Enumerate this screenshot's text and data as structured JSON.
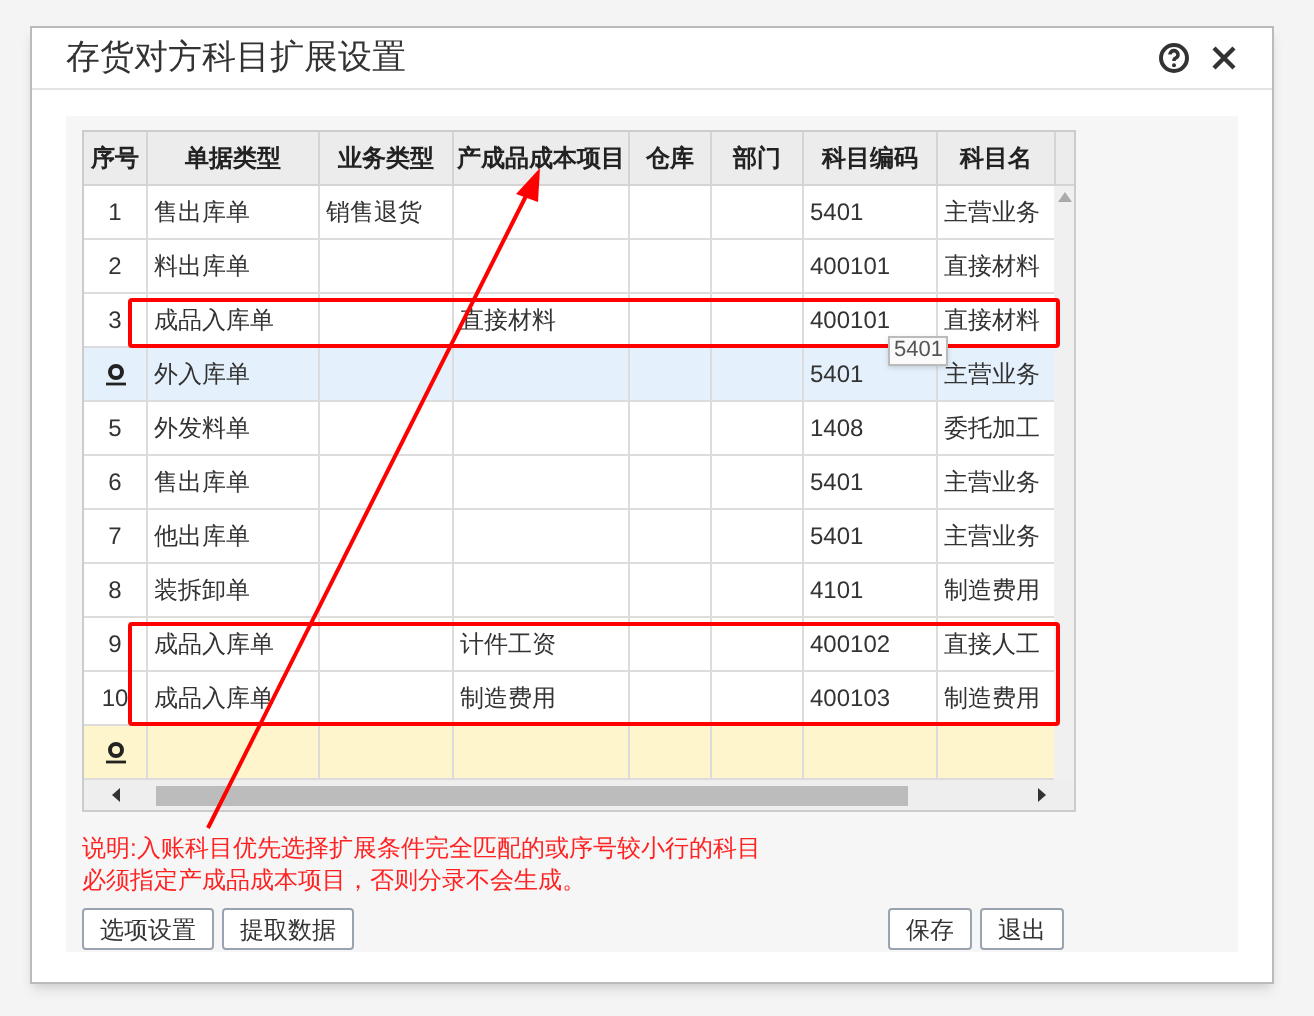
{
  "dialog": {
    "title": "存货对方科目扩展设置"
  },
  "table": {
    "columns": [
      "序号",
      "单据类型",
      "业务类型",
      "产成品成本项目",
      "仓库",
      "部门",
      "科目编码",
      "科目名"
    ],
    "rows": [
      {
        "kind": "data",
        "selected": false,
        "highlighted": false,
        "cells": [
          "1",
          "售出库单",
          "销售退货",
          "",
          "",
          "",
          "5401",
          "主营业务"
        ]
      },
      {
        "kind": "data",
        "selected": false,
        "highlighted": false,
        "cells": [
          "2",
          "料出库单",
          "",
          "",
          "",
          "",
          "400101",
          "直接材料"
        ]
      },
      {
        "kind": "data",
        "selected": false,
        "highlighted": true,
        "cells": [
          "3",
          "成品入库单",
          "",
          "直接材料",
          "",
          "",
          "400101",
          "直接材料"
        ]
      },
      {
        "kind": "data",
        "selected": true,
        "highlighted": false,
        "cells": [
          "",
          "外入库单",
          "",
          "",
          "",
          "",
          "5401",
          "主营业务"
        ]
      },
      {
        "kind": "data",
        "selected": false,
        "highlighted": false,
        "cells": [
          "5",
          "外发料单",
          "",
          "",
          "",
          "",
          "1408",
          "委托加工"
        ]
      },
      {
        "kind": "data",
        "selected": false,
        "highlighted": false,
        "cells": [
          "6",
          "售出库单",
          "",
          "",
          "",
          "",
          "5401",
          "主营业务"
        ]
      },
      {
        "kind": "data",
        "selected": false,
        "highlighted": false,
        "cells": [
          "7",
          "他出库单",
          "",
          "",
          "",
          "",
          "5401",
          "主营业务"
        ]
      },
      {
        "kind": "data",
        "selected": false,
        "highlighted": false,
        "cells": [
          "8",
          "装拆卸单",
          "",
          "",
          "",
          "",
          "4101",
          "制造费用"
        ]
      },
      {
        "kind": "data",
        "selected": false,
        "highlighted": true,
        "cells": [
          "9",
          "成品入库单",
          "",
          "计件工资",
          "",
          "",
          "400102",
          "直接人工"
        ]
      },
      {
        "kind": "data",
        "selected": false,
        "highlighted": true,
        "cells": [
          "10",
          "成品入库单",
          "",
          "制造费用",
          "",
          "",
          "400103",
          "制造费用"
        ]
      },
      {
        "kind": "new",
        "selected": false,
        "highlighted": false,
        "cells": [
          "",
          "",
          "",
          "",
          "",
          "",
          "",
          ""
        ]
      }
    ],
    "tooltip": "5401"
  },
  "note": [
    "说明:入账科目优先选择扩展条件完全匹配的或序号较小行的科目",
    "必须指定产成品成本项目，否则分录不会生成。"
  ],
  "left_buttons": [
    "选项设置",
    "提取数据"
  ],
  "right_buttons": [
    "保存",
    "退出"
  ],
  "pointer_arrow": true
}
